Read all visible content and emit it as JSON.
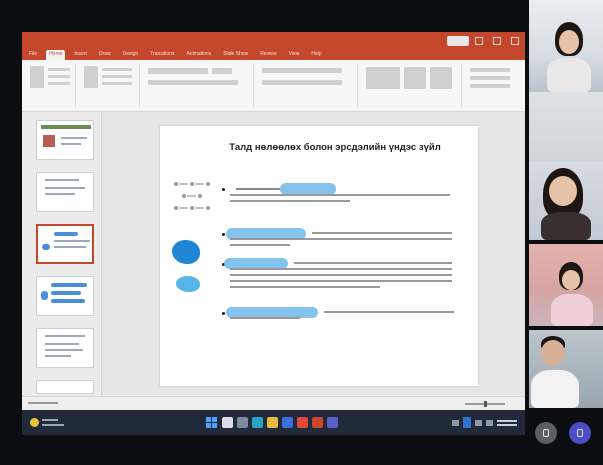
{
  "presentation": {
    "slide_title": "Талд нөлөөлөх болон эрсдэлийн үндэс зүйл",
    "ribbon_tabs": [
      "File",
      "Home",
      "Insert",
      "Draw",
      "Design",
      "Transitions",
      "Animations",
      "Slide Show",
      "Review",
      "View",
      "Help"
    ],
    "active_tab": "Home",
    "thumbnail_count": 6,
    "selected_thumbnail": 3,
    "bullets": [
      {
        "id": "b1",
        "highlight_color": "#6fb8ea"
      },
      {
        "id": "b2",
        "highlight_color": "#6fb8ea"
      },
      {
        "id": "b3",
        "highlight_color": "#6fb8ea"
      },
      {
        "id": "b4",
        "highlight_color": "#6fb8ea"
      }
    ]
  },
  "taskbar": {
    "icons": [
      "start-icon",
      "search-icon",
      "task-view-icon",
      "edge-icon",
      "explorer-icon",
      "store-icon",
      "chrome-icon",
      "powerpoint-icon",
      "teams-icon"
    ]
  },
  "meeting": {
    "participants": 4,
    "controls": [
      "share-icon",
      "participants-icon"
    ]
  },
  "colors": {
    "accent": "#c4462b",
    "highlight": "#6fb8ea",
    "blob": "#1f86d6"
  }
}
